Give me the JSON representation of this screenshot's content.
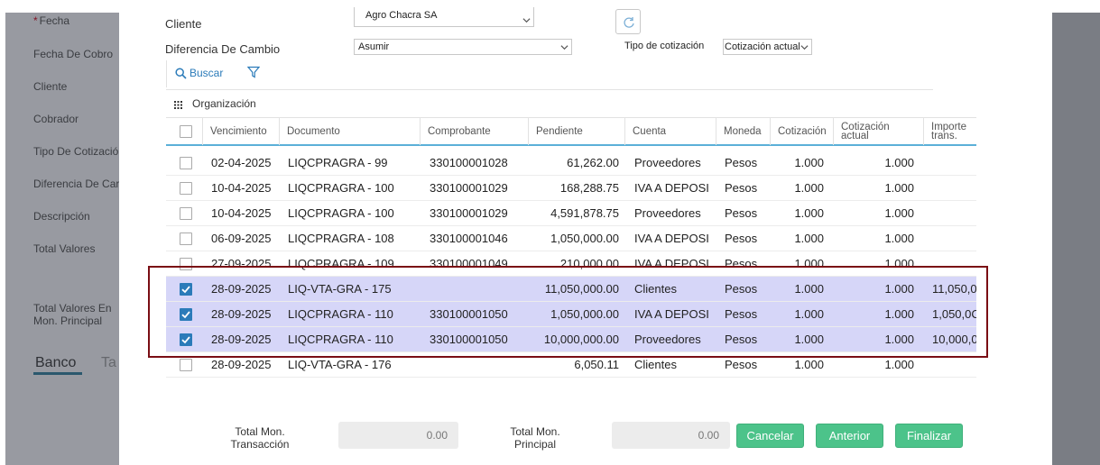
{
  "background": {
    "fields": [
      {
        "label": "Fecha",
        "required": true
      },
      {
        "label": "Fecha De Cobro"
      },
      {
        "label": "Cliente"
      },
      {
        "label": "Cobrador"
      },
      {
        "label": "Tipo De Cotizació"
      },
      {
        "label": "Diferencia De Car"
      },
      {
        "label": "Descripción"
      },
      {
        "label": "Total Valores"
      },
      {
        "label": "Total Valores En"
      },
      {
        "label": "Mon. Principal"
      }
    ],
    "tabs": [
      "Banco",
      "Ta"
    ]
  },
  "modal": {
    "cliente_label": "Cliente",
    "cliente_value": "Agro Chacra SA",
    "diferencia_label": "Diferencia De Cambio",
    "diferencia_value": "Asumir",
    "tipo_cotizacion_label": "Tipo de cotización",
    "tipo_cotizacion_value": "Cotización actual",
    "buscar_label": "Buscar",
    "organizacion_label": "Organización"
  },
  "grid": {
    "columns": [
      "Vencimiento",
      "Documento",
      "Comprobante",
      "Pendiente",
      "Cuenta",
      "Moneda",
      "Cotización",
      "Cotización actual",
      "Importe trans."
    ],
    "rows": [
      {
        "checked": false,
        "vencimiento": "02-04-2025",
        "documento": "LIQCPRAGRA - 99",
        "comprobante": "330100001028",
        "pendiente": "61,262.00",
        "cuenta": "Proveedores",
        "moneda": "Pesos",
        "cotizacion": "1.000",
        "cotizacion_actual": "1.000",
        "importe": ""
      },
      {
        "checked": false,
        "vencimiento": "10-04-2025",
        "documento": "LIQCPRAGRA - 100",
        "comprobante": "330100001029",
        "pendiente": "168,288.75",
        "cuenta": "IVA A DEPOSI",
        "moneda": "Pesos",
        "cotizacion": "1.000",
        "cotizacion_actual": "1.000",
        "importe": ""
      },
      {
        "checked": false,
        "vencimiento": "10-04-2025",
        "documento": "LIQCPRAGRA - 100",
        "comprobante": "330100001029",
        "pendiente": "4,591,878.75",
        "cuenta": "Proveedores",
        "moneda": "Pesos",
        "cotizacion": "1.000",
        "cotizacion_actual": "1.000",
        "importe": ""
      },
      {
        "checked": false,
        "vencimiento": "06-09-2025",
        "documento": "LIQCPRAGRA - 108",
        "comprobante": "330100001046",
        "pendiente": "1,050,000.00",
        "cuenta": "IVA A DEPOSI",
        "moneda": "Pesos",
        "cotizacion": "1.000",
        "cotizacion_actual": "1.000",
        "importe": ""
      },
      {
        "checked": false,
        "vencimiento": "27-09-2025",
        "documento": "LIQCPRAGRA - 109",
        "comprobante": "330100001049",
        "pendiente": "210,000.00",
        "cuenta": "IVA A DEPOSI",
        "moneda": "Pesos",
        "cotizacion": "1.000",
        "cotizacion_actual": "1.000",
        "importe": ""
      },
      {
        "checked": true,
        "vencimiento": "28-09-2025",
        "documento": "LIQ-VTA-GRA - 175",
        "comprobante": "",
        "pendiente": "11,050,000.00",
        "cuenta": "Clientes",
        "moneda": "Pesos",
        "cotizacion": "1.000",
        "cotizacion_actual": "1.000",
        "importe": "11,050,0("
      },
      {
        "checked": true,
        "vencimiento": "28-09-2025",
        "documento": "LIQCPRAGRA - 110",
        "comprobante": "330100001050",
        "pendiente": "1,050,000.00",
        "cuenta": "IVA A DEPOSI",
        "moneda": "Pesos",
        "cotizacion": "1.000",
        "cotizacion_actual": "1.000",
        "importe": "1,050,0C"
      },
      {
        "checked": true,
        "vencimiento": "28-09-2025",
        "documento": "LIQCPRAGRA - 110",
        "comprobante": "330100001050",
        "pendiente": "10,000,000.00",
        "cuenta": "Proveedores",
        "moneda": "Pesos",
        "cotizacion": "1.000",
        "cotizacion_actual": "1.000",
        "importe": "10,000,0("
      },
      {
        "checked": false,
        "vencimiento": "28-09-2025",
        "documento": "LIQ-VTA-GRA - 176",
        "comprobante": "",
        "pendiente": "6,050.11",
        "cuenta": "Clientes",
        "moneda": "Pesos",
        "cotizacion": "1.000",
        "cotizacion_actual": "1.000",
        "importe": ""
      }
    ]
  },
  "footer": {
    "total_transaccion_label_1": "Total Mon.",
    "total_transaccion_label_2": "Transacción",
    "total_transaccion_value": "0.00",
    "total_principal_label_1": "Total Mon.",
    "total_principal_label_2": "Principal",
    "total_principal_value": "0.00",
    "cancel_label": "Cancelar",
    "prev_label": "Anterior",
    "finish_label": "Finalizar"
  },
  "colors": {
    "accent_green": "#4cc38a",
    "selected_row": "#d6d6f8",
    "highlight_border": "#7a0e14",
    "checkbox_blue": "#2b7bb9",
    "header_underline": "#5bb0d8"
  }
}
